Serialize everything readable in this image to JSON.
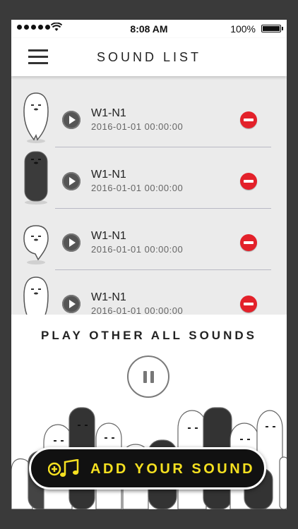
{
  "status_bar": {
    "time": "8:08 AM",
    "battery": "100%"
  },
  "header": {
    "title": "SOUND LIST"
  },
  "sounds": [
    {
      "name": "W1-N1",
      "date": "2016-01-01 00:00:00"
    },
    {
      "name": "W1-N1",
      "date": "2016-01-01 00:00:00"
    },
    {
      "name": "W1-N1",
      "date": "2016-01-01 00:00:00"
    },
    {
      "name": "W1-N1",
      "date": "2016-01-01 00:00:00"
    }
  ],
  "player": {
    "play_other_label": "PLAY OTHER ALL SOUNDS"
  },
  "add_button": {
    "label": "ADD YOUR SOUND",
    "icon": "add-music-icon",
    "text_color": "#f5e020"
  },
  "colors": {
    "delete": "#e3212a",
    "list_bg": "#ebebeb",
    "frame": "#3a3a3a"
  }
}
